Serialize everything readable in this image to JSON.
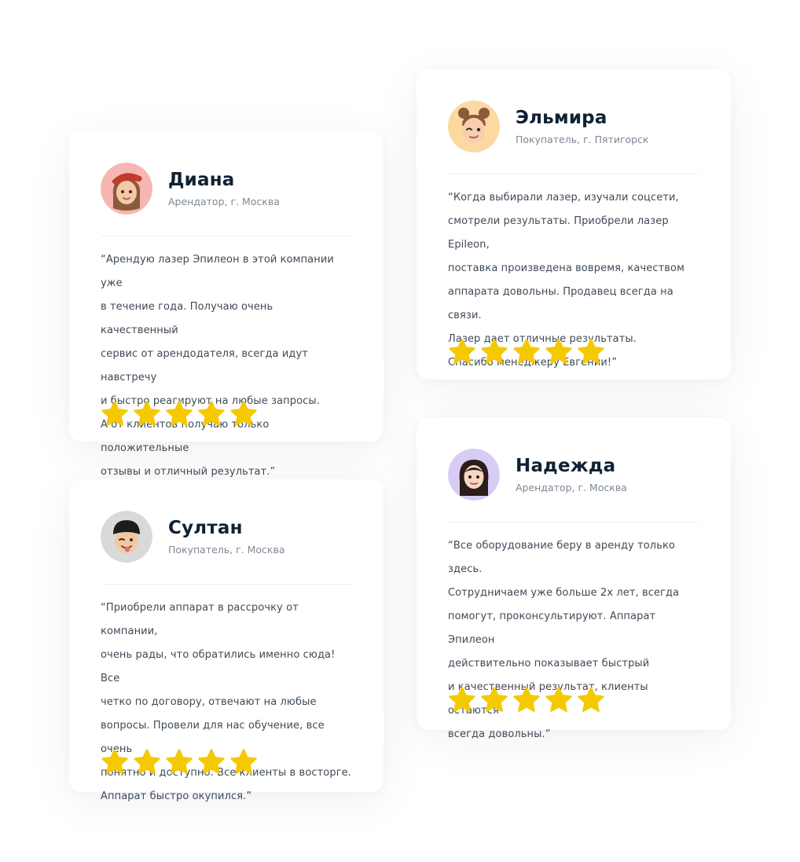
{
  "colors": {
    "star": "#f5c900",
    "name": "#0f2233",
    "role": "#7d8894",
    "text": "#3f4a56",
    "divider": "#eef0f3"
  },
  "reviews": [
    {
      "name": "Диана",
      "role": "Арендатор, г. Москва",
      "text": "“Арендую лазер Эпилеон в этой компании уже\nв течение года. Получаю очень качественный\nсервис от арендодателя, всегда идут навстречу\nи быстро реагируют на любые запросы.\nА от клиентов получаю только положительные\nотзывы и отличный результат.”",
      "rating": 5,
      "avatar_icon": "woman-red-beret-avatar-icon",
      "avatar_bg": "#f7b6b2"
    },
    {
      "name": "Эльмира",
      "role": "Покупатель, г. Пятигорск",
      "text": "“Когда выбирали лазер, изучали соцсети,\nсмотрели результаты. Приобрели лазер Epileon,\nпоставка произведена вовремя, качеством\nаппарата довольны. Продавец всегда на связи.\nЛазер дает отличные результаты.\nСпасибо менеджеру Евгении!”",
      "rating": 5,
      "avatar_icon": "woman-hair-buns-avatar-icon",
      "avatar_bg": "#fbd9a0"
    },
    {
      "name": "Султан",
      "role": "Покупатель, г. Москва",
      "text": "“Приобрели аппарат в рассрочку от компании,\nочень рады, что обратились именно сюда! Все\nчетко по договору, отвечают на любые\nвопросы. Провели для нас обучение, все очень\nпонятно и доступно. Все клиенты в восторге.\nАппарат быстро окупился.”",
      "rating": 5,
      "avatar_icon": "man-black-cap-avatar-icon",
      "avatar_bg": "#d9d9d9"
    },
    {
      "name": "Надежда",
      "role": "Арендатор, г. Москва",
      "text": "“Все оборудование беру в аренду только здесь.\nСотрудничаем уже больше 2х лет, всегда\nпомогут, проконсультируют. Аппарат Эпилеон\nдействительно показывает быстрый\nи качественный результат, клиенты остаются\nвсегда довольны.”",
      "rating": 5,
      "avatar_icon": "woman-dark-hair-avatar-icon",
      "avatar_bg": "#d8ccf5"
    }
  ]
}
